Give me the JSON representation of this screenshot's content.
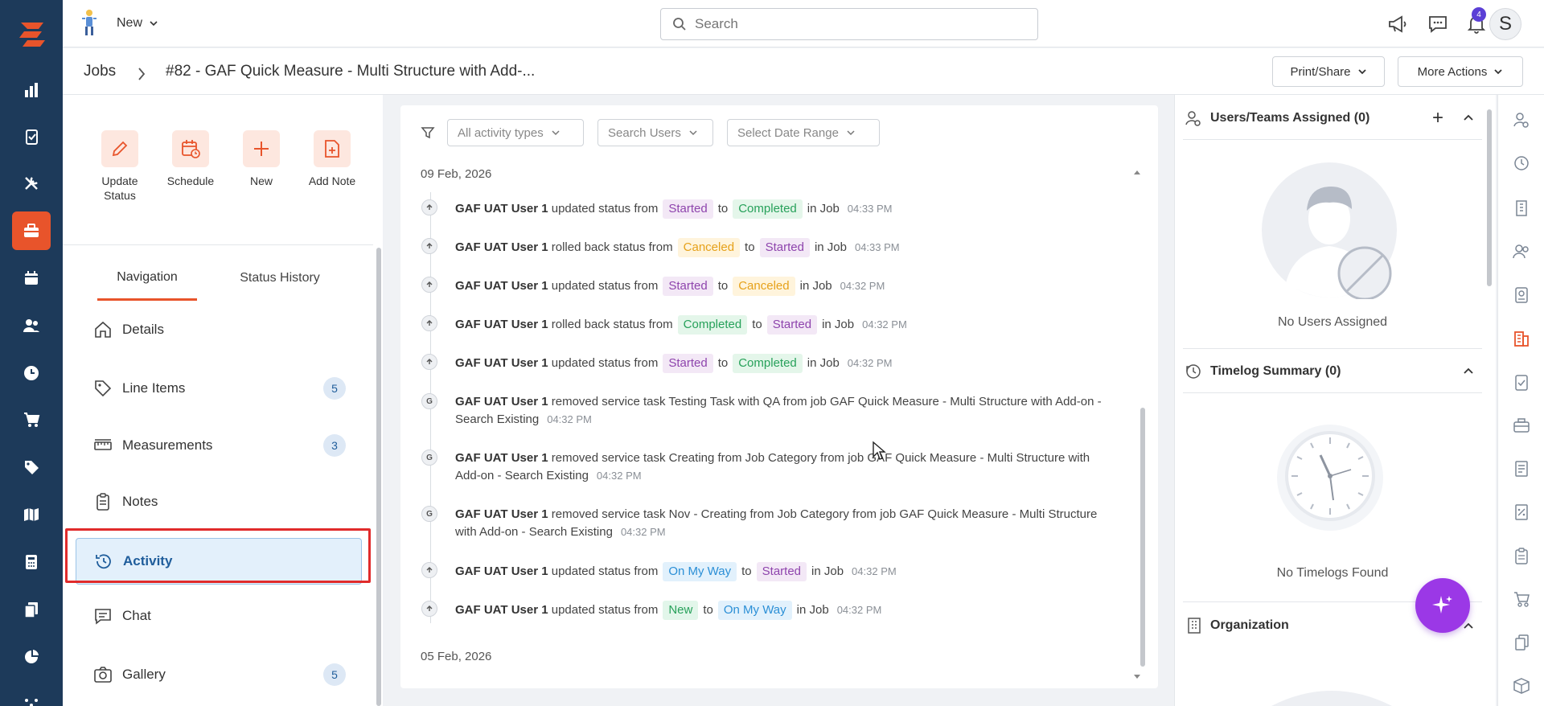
{
  "header": {
    "new_label": "New",
    "search_placeholder": "Search",
    "notification_count": "4",
    "avatar_initial": "S",
    "accent_color": "#e8542b"
  },
  "breadcrumb": {
    "root": "Jobs",
    "current": "#82 - GAF Quick Measure - Multi Structure with Add-..."
  },
  "top_actions": {
    "print_share": "Print/Share",
    "more_actions": "More Actions"
  },
  "quick_actions": [
    {
      "label": "Update Status",
      "icon": "pencil-icon"
    },
    {
      "label": "Schedule",
      "icon": "calendar-clock-icon"
    },
    {
      "label": "New",
      "icon": "plus-icon"
    },
    {
      "label": "Add Note",
      "icon": "note-add-icon"
    }
  ],
  "tabs": {
    "navigation": "Navigation",
    "status_history": "Status History"
  },
  "nav_items": [
    {
      "label": "Details",
      "icon": "home-icon",
      "count": null
    },
    {
      "label": "Line Items",
      "icon": "tag-icon",
      "count": "5"
    },
    {
      "label": "Measurements",
      "icon": "ruler-icon",
      "count": "3"
    },
    {
      "label": "Notes",
      "icon": "clipboard-icon",
      "count": null
    },
    {
      "label": "Activity",
      "icon": "history-icon",
      "count": null,
      "selected": true
    },
    {
      "label": "Chat",
      "icon": "chat-icon",
      "count": null
    },
    {
      "label": "Gallery",
      "icon": "camera-icon",
      "count": "5"
    }
  ],
  "activity": {
    "filters": {
      "types": "All activity types",
      "users": "Search Users",
      "dates": "Select Date Range"
    },
    "groups": [
      {
        "date": "09 Feb, 2026"
      },
      {
        "date": "05 Feb, 2026"
      }
    ],
    "entries": [
      {
        "icon": "up-arrow",
        "user": "GAF UAT User 1",
        "action": "updated status from",
        "from": "Started",
        "to": "Completed",
        "suffix": "in Job",
        "time": "04:33 PM"
      },
      {
        "icon": "up-arrow",
        "user": "GAF UAT User 1",
        "action": "rolled back status from",
        "from": "Canceled",
        "to": "Started",
        "suffix": "in Job",
        "time": "04:33 PM"
      },
      {
        "icon": "up-arrow",
        "user": "GAF UAT User 1",
        "action": "updated status from",
        "from": "Started",
        "to": "Canceled",
        "suffix": "in Job",
        "time": "04:32 PM"
      },
      {
        "icon": "up-arrow",
        "user": "GAF UAT User 1",
        "action": "rolled back status from",
        "from": "Completed",
        "to": "Started",
        "suffix": "in Job",
        "time": "04:32 PM"
      },
      {
        "icon": "up-arrow",
        "user": "GAF UAT User 1",
        "action": "updated status from",
        "from": "Started",
        "to": "Completed",
        "suffix": "in Job",
        "time": "04:32 PM"
      },
      {
        "icon": "G",
        "user": "GAF UAT User 1",
        "text": "removed service task Testing Task with QA from job GAF Quick Measure - Multi Structure with Add-on - Search Existing",
        "time": "04:32 PM"
      },
      {
        "icon": "G",
        "user": "GAF UAT User 1",
        "text": "removed service task Creating from Job Category from job GAF Quick Measure - Multi Structure with Add-on - Search Existing",
        "time": "04:32 PM"
      },
      {
        "icon": "G",
        "user": "GAF UAT User 1",
        "text": "removed service task Nov - Creating from Job Category from job GAF Quick Measure - Multi Structure with Add-on - Search Existing",
        "time": "04:32 PM"
      },
      {
        "icon": "up-arrow",
        "user": "GAF UAT User 1",
        "action": "updated status from",
        "from": "On My Way",
        "to": "Started",
        "suffix": "in Job",
        "time": "04:32 PM"
      },
      {
        "icon": "up-arrow",
        "user": "GAF UAT User 1",
        "action": "updated status from",
        "from": "New",
        "to": "On My Way",
        "suffix": "in Job",
        "time": "04:32 PM"
      }
    ],
    "to_word": "to"
  },
  "right": {
    "users_title": "Users/Teams Assigned (0)",
    "users_empty": "No Users Assigned",
    "timelog_title": "Timelog Summary (0)",
    "timelog_empty": "No Timelogs Found",
    "org_title": "Organization"
  }
}
